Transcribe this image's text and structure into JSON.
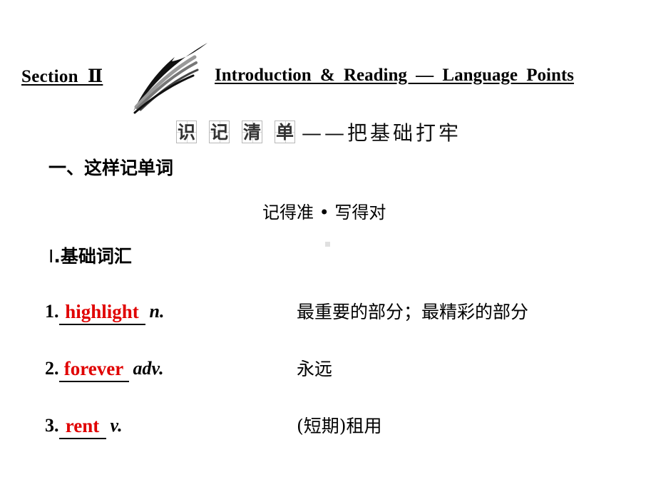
{
  "header": {
    "section_label": "Section  Ⅱ",
    "title": "Introduction & Reading — Language Points",
    "brush_icon": "brush-stroke-decoration"
  },
  "banner": {
    "boxed_chars": [
      "识",
      "记",
      "清",
      "单"
    ],
    "tail": "——把基础打牢"
  },
  "main": {
    "heading": "一、这样记单词",
    "subtitle": "记得准 • 写得对",
    "sub_heading_roman": "Ⅰ",
    "sub_heading_text": ".基础词汇",
    "vocab": [
      {
        "number": "1.",
        "answer": "highlight",
        "pos": "n.",
        "meaning": "最重要的部分；最精彩的部分"
      },
      {
        "number": "2.",
        "answer": "forever",
        "pos": "adv.",
        "meaning": "永远"
      },
      {
        "number": "3.",
        "answer": "rent",
        "pos": "v.",
        "meaning": "(短期)租用"
      }
    ]
  },
  "colors": {
    "answer": "#e00000",
    "text": "#000000"
  }
}
